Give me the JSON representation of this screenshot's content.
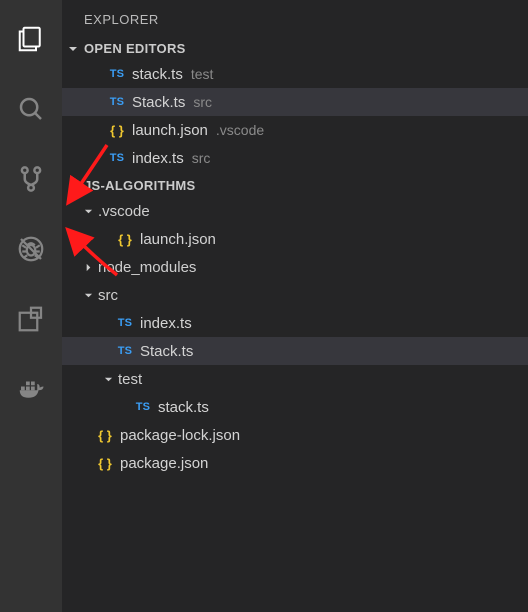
{
  "sidebar": {
    "title": "EXPLORER"
  },
  "sections": {
    "openEditors": {
      "label": "OPEN EDITORS"
    },
    "workspace": {
      "label": "JS-ALGORITHMS"
    }
  },
  "openEditors": [
    {
      "badge": "TS",
      "badgeKind": "ts",
      "name": "stack.ts",
      "desc": "test",
      "selected": false
    },
    {
      "badge": "TS",
      "badgeKind": "ts",
      "name": "Stack.ts",
      "desc": "src",
      "selected": true
    },
    {
      "badge": "{ }",
      "badgeKind": "json",
      "name": "launch.json",
      "desc": ".vscode",
      "selected": false
    },
    {
      "badge": "TS",
      "badgeKind": "ts",
      "name": "index.ts",
      "desc": "src",
      "selected": false
    }
  ],
  "tree": [
    {
      "kind": "folder",
      "name": ".vscode",
      "expanded": true,
      "indent": 1
    },
    {
      "kind": "file",
      "badge": "{ }",
      "badgeKind": "json",
      "name": "launch.json",
      "indent": 2
    },
    {
      "kind": "folder",
      "name": "node_modules",
      "expanded": false,
      "indent": 1
    },
    {
      "kind": "folder",
      "name": "src",
      "expanded": true,
      "indent": 1
    },
    {
      "kind": "file",
      "badge": "TS",
      "badgeKind": "ts",
      "name": "index.ts",
      "indent": 2
    },
    {
      "kind": "file",
      "badge": "TS",
      "badgeKind": "ts",
      "name": "Stack.ts",
      "indent": 2,
      "selected": true
    },
    {
      "kind": "folder",
      "name": "test",
      "expanded": true,
      "indent": 2
    },
    {
      "kind": "file",
      "badge": "TS",
      "badgeKind": "ts",
      "name": "stack.ts",
      "indent": 3
    },
    {
      "kind": "file",
      "badge": "{ }",
      "badgeKind": "json",
      "name": "package-lock.json",
      "indent": 1
    },
    {
      "kind": "file",
      "badge": "{ }",
      "badgeKind": "json",
      "name": "package.json",
      "indent": 1
    }
  ],
  "activity": [
    "files",
    "search",
    "scm",
    "debug",
    "extensions",
    "docker"
  ],
  "annotationColor": "#ff1a1a"
}
